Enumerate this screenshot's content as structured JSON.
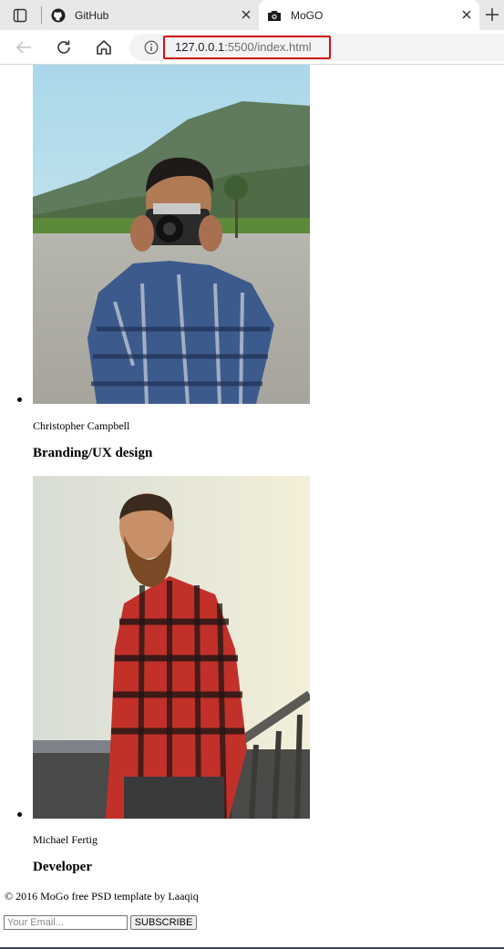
{
  "browser": {
    "tabs": [
      {
        "label": "GitHub",
        "icon": "github-icon"
      },
      {
        "label": "MoGO",
        "icon": "camera-icon",
        "active": true
      }
    ],
    "url_host": "127.0.0.1",
    "url_path": ":5500/index.html",
    "url_highlight_color": "#d10f0f"
  },
  "team": [
    {
      "name": "Christopher Campbell",
      "role": "Branding/UX design",
      "photo": "photographer-with-camera"
    },
    {
      "name": "Michael Fertig",
      "role": "Developer",
      "photo": "bearded-man-in-red-plaid-shirt"
    }
  ],
  "footer": {
    "copyright": "© 2016 MoGo free PSD template by Laaqiq",
    "email_placeholder": "Your Email...",
    "subscribe_label": "SUBSCRIBE"
  }
}
